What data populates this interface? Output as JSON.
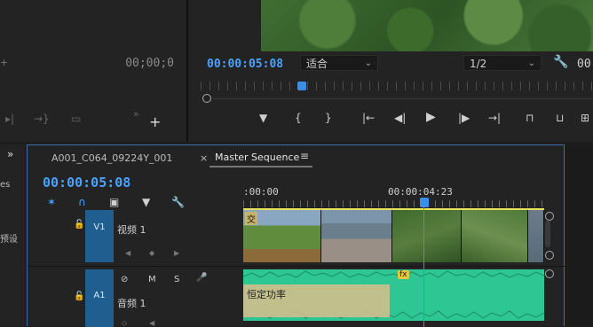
{
  "source_monitor": {
    "timecode": "00;00;0"
  },
  "program_monitor": {
    "timecode": "00:00:05:08",
    "fit": "适合",
    "resolution": "1/2",
    "timecode_right": "00"
  },
  "panels": {
    "left_expand": "»",
    "left_label": "es",
    "left_label2": "预设"
  },
  "timeline": {
    "tab_clip": "A001_C064_09224Y_001",
    "tab_close": "×",
    "tab_sequence": "Master Sequence",
    "tab_menu": "≡",
    "timecode": "00:00:05:08",
    "ruler_start": ":00:00",
    "ruler_mark": "00:00:04:23",
    "tracks": {
      "v1": {
        "target": "V1",
        "name": "视频 1"
      },
      "a1": {
        "target": "A1",
        "name": "音频 1",
        "m": "M",
        "s": "S"
      }
    },
    "clip1_label": "交",
    "audio_effect": "恒定功率",
    "fx_badge": "fx"
  },
  "icons": {
    "wrench": "wrench-icon",
    "add": "add-icon",
    "play": "play-icon"
  }
}
